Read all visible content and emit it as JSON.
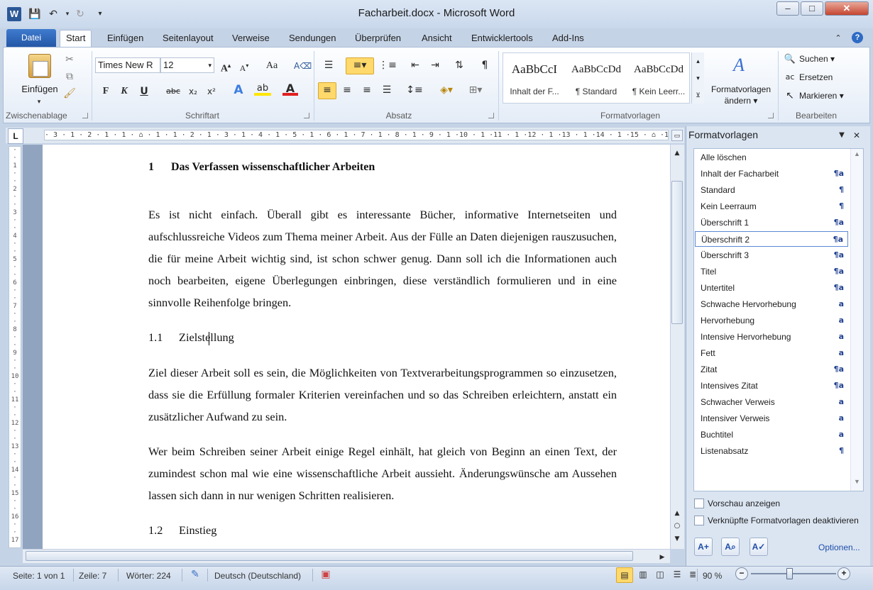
{
  "window": {
    "title": "Facharbeit.docx - Microsoft Word",
    "app_icon": "W"
  },
  "tabs": [
    "Datei",
    "Start",
    "Einfügen",
    "Seitenlayout",
    "Verweise",
    "Sendungen",
    "Überprüfen",
    "Ansicht",
    "Entwicklertools",
    "Add-Ins"
  ],
  "ribbon": {
    "clipboard": {
      "paste_label": "Einfügen",
      "group": "Zwischenablage"
    },
    "font": {
      "name": "Times New R",
      "size": "12",
      "group": "Schriftart",
      "bold": "F",
      "italic": "K",
      "underline": "U",
      "strike": "abc",
      "sub": "x₂",
      "sup": "x²",
      "case": "Aa"
    },
    "paragraph": {
      "group": "Absatz"
    },
    "styles": {
      "samples": [
        "AaBbCcI",
        "AaBbCcDd",
        "AaBbCcDd"
      ],
      "names": [
        "Inhalt der F...",
        "¶ Standard",
        "¶ Kein Leerr..."
      ],
      "group": "Formatvorlagen",
      "change_label_1": "Formatvorlagen",
      "change_label_2": "ändern"
    },
    "editing": {
      "find": "Suchen",
      "replace": "Ersetzen",
      "select": "Markieren",
      "group": "Bearbeiten"
    }
  },
  "ruler": {
    "corner": "L",
    "h_text": "· 3 · 1 · 2 · 1 · 1 · ⌂ · 1 · 1 · 2 · 1 · 3 · 1 · 4 · 1 · 5 · 1 · 6 · 1 · 7 · 1 · 8 · 1 · 9 · 1 ·10 · 1 ·11 · 1 ·12 · 1 ·13 · 1 ·14 · 1 ·15 · ⌂ ·16 · 1 ·17 ·"
  },
  "document": {
    "heading1": "1      Das Verfassen wissenschaftlicher Arbeiten",
    "para1": "Es ist nicht einfach. Überall gibt es interessante Bücher, informative Internetseiten und aufschlussreiche Videos zum Thema meiner Arbeit. Aus der Fülle an Daten diejenigen rauszusuchen, die für meine Arbeit wichtig sind, ist schon schwer genug. Dann soll ich die Informationen auch noch bearbeiten, eigene Überlegungen einbringen, diese verständlich formulieren und in eine sinnvolle Reihenfolge bringen.",
    "h11_num": "1.1",
    "h11_text": "Zielstellung",
    "para2": "Ziel dieser Arbeit soll es sein, die Möglichkeiten von Textverarbeitungsprogrammen so einzusetzen, dass sie die Erfüllung formaler Kriterien vereinfachen und so das Schreiben erleichtern, anstatt ein zusätzlicher Aufwand zu sein.",
    "para3": "Wer beim Schreiben seiner Arbeit einige Regel einhält, hat gleich von Beginn an einen Text, der zumindest schon mal wie eine wissenschaftliche Arbeit aussieht. Änderungswünsche am Aussehen lassen sich dann in nur wenigen Schritten realisieren.",
    "h12_num": "1.2",
    "h12_text": "Einstieg"
  },
  "styles_pane": {
    "title": "Formatvorlagen",
    "items": [
      {
        "name": "Alle löschen",
        "mark": ""
      },
      {
        "name": "Inhalt der Facharbeit",
        "mark": "¶a"
      },
      {
        "name": "Standard",
        "mark": "¶"
      },
      {
        "name": "Kein Leerraum",
        "mark": "¶"
      },
      {
        "name": "Überschrift 1",
        "mark": "¶a"
      },
      {
        "name": "Überschrift 2",
        "mark": "¶a"
      },
      {
        "name": "Überschrift 3",
        "mark": "¶a"
      },
      {
        "name": "Titel",
        "mark": "¶a"
      },
      {
        "name": "Untertitel",
        "mark": "¶a"
      },
      {
        "name": "Schwache Hervorhebung",
        "mark": "a"
      },
      {
        "name": "Hervorhebung",
        "mark": "a"
      },
      {
        "name": "Intensive Hervorhebung",
        "mark": "a"
      },
      {
        "name": "Fett",
        "mark": "a"
      },
      {
        "name": "Zitat",
        "mark": "¶a"
      },
      {
        "name": "Intensives Zitat",
        "mark": "¶a"
      },
      {
        "name": "Schwacher Verweis",
        "mark": "a"
      },
      {
        "name": "Intensiver Verweis",
        "mark": "a"
      },
      {
        "name": "Buchtitel",
        "mark": "a"
      },
      {
        "name": "Listenabsatz",
        "mark": "¶"
      }
    ],
    "selected": "Überschrift 2",
    "preview_label": "Vorschau anzeigen",
    "linked_label": "Verknüpfte Formatvorlagen deaktivieren",
    "options_link": "Optionen..."
  },
  "status": {
    "page": "Seite: 1 von 1",
    "line": "Zeile: 7",
    "words": "Wörter: 224",
    "language": "Deutsch (Deutschland)",
    "zoom": "90 %",
    "zoom_level": 0.45
  },
  "colors": {
    "accent": "#2b5797",
    "selection": "#ffd96b"
  }
}
